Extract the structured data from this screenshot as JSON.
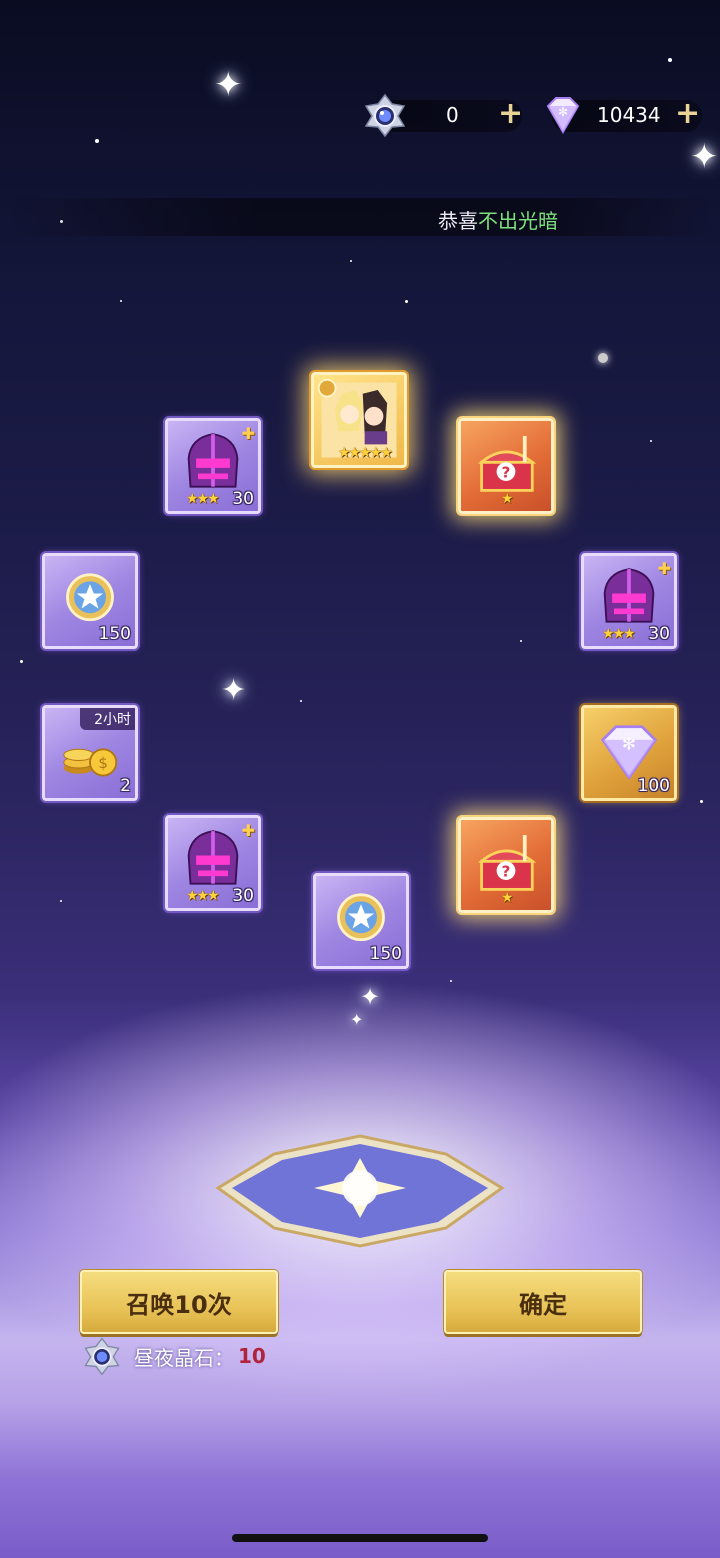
{
  "currency": {
    "crystal": {
      "icon": "day-night-crystal-icon",
      "value": "0"
    },
    "diamond": {
      "icon": "diamond-icon",
      "value": "10434"
    },
    "plus_symbol": "+"
  },
  "banner": {
    "prefix": "恭喜",
    "highlight": "不出光暗"
  },
  "rewards": [
    {
      "icon": "hero-card-icon",
      "stars": "★★★★★"
    },
    {
      "icon": "helmet-shard-icon",
      "stars": "★★★",
      "count": "30"
    },
    {
      "icon": "mystery-chest-icon",
      "stars": "★"
    },
    {
      "icon": "star-medal-icon",
      "count": "150"
    },
    {
      "icon": "helmet-shard-icon",
      "stars": "★★★",
      "count": "30"
    },
    {
      "icon": "gold-coins-icon",
      "time": "2小时",
      "count": "2"
    },
    {
      "icon": "diamond-icon",
      "count": "100"
    },
    {
      "icon": "helmet-shard-icon",
      "stars": "★★★",
      "count": "30"
    },
    {
      "icon": "mystery-chest-icon",
      "stars": "★"
    },
    {
      "icon": "star-medal-icon",
      "count": "150"
    }
  ],
  "actions": {
    "summon_label": "召唤10次",
    "confirm_label": "确定",
    "cost_label": "昼夜晶石：",
    "cost_value": "10"
  },
  "colors": {
    "highlight": "#7ee07e",
    "cost": "#b0233a",
    "button": "#e9c458"
  }
}
